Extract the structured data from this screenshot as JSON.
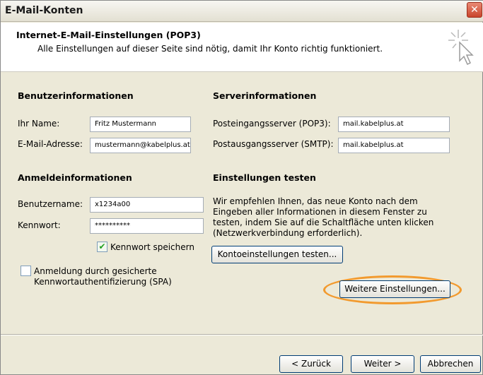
{
  "window": {
    "title": "E-Mail-Konten",
    "close_label": "✕"
  },
  "header": {
    "title": "Internet-E-Mail-Einstellungen (POP3)",
    "subtitle": "Alle Einstellungen auf dieser Seite sind nötig, damit Ihr Konto richtig funktioniert."
  },
  "user_info": {
    "title": "Benutzerinformationen",
    "name_label": "Ihr Name:",
    "name_value": "Fritz Mustermann",
    "email_label": "E-Mail-Adresse:",
    "email_value": "mustermann@kabelplus.at"
  },
  "server_info": {
    "title": "Serverinformationen",
    "incoming_label": "Posteingangsserver (POP3):",
    "incoming_value": "mail.kabelplus.at",
    "outgoing_label": "Postausgangsserver (SMTP):",
    "outgoing_value": "mail.kabelplus.at"
  },
  "login_info": {
    "title": "Anmeldeinformationen",
    "username_label": "Benutzername:",
    "username_value": "x1234a00",
    "password_label": "Kennwort:",
    "password_value": "**********",
    "remember_label": "Kennwort speichern",
    "remember_checked": true,
    "spa_label_line1": "Anmeldung durch gesicherte",
    "spa_label_line2": "Kennwortauthentifizierung (SPA)",
    "spa_checked": false
  },
  "test_settings": {
    "title": "Einstellungen testen",
    "desc_line1": "Wir empfehlen Ihnen, das neue Konto nach dem",
    "desc_line2": "Eingeben aller Informationen in diesem Fenster zu",
    "desc_line3": "testen, indem Sie auf die Schaltfläche unten klicken",
    "desc_line4": "(Netzwerkverbindung erforderlich).",
    "test_button": "Kontoeinstellungen testen...",
    "more_settings_button": "Weitere Einstellungen..."
  },
  "footer": {
    "back_button": "< Zurück",
    "next_button": "Weiter >",
    "cancel_button": "Abbrechen"
  },
  "colors": {
    "highlight": "#f29a2e",
    "checkmark": "#21a121"
  }
}
